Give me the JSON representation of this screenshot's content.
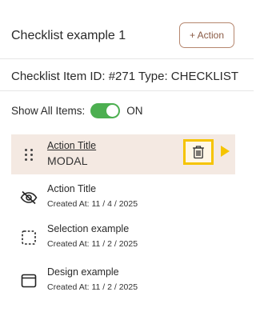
{
  "header": {
    "title": "Checklist example 1",
    "action_button": "+ Action"
  },
  "meta": {
    "text": "Checklist Item ID: #271 Type: CHECKLIST"
  },
  "toggle": {
    "label": "Show All Items:",
    "state_text": "ON",
    "on": true,
    "color": "#4caf50"
  },
  "items": [
    {
      "title": "Action Title",
      "subtitle": "MODAL",
      "icon": "drag-handle-icon",
      "active": true
    },
    {
      "title": "Action Title",
      "subtitle": "Created At: 11 / 4 / 2025",
      "icon": "eye-off-icon"
    },
    {
      "title": "Selection example",
      "subtitle": "Created At: 11 / 2 / 2025",
      "icon": "dashed-square-icon"
    },
    {
      "title": "Design example",
      "subtitle": "Created At: 11 / 2 / 2025",
      "icon": "window-icon"
    }
  ],
  "colors": {
    "accent": "#b5866e",
    "highlight": "#f5c400",
    "active_row": "#f4e9e2"
  }
}
